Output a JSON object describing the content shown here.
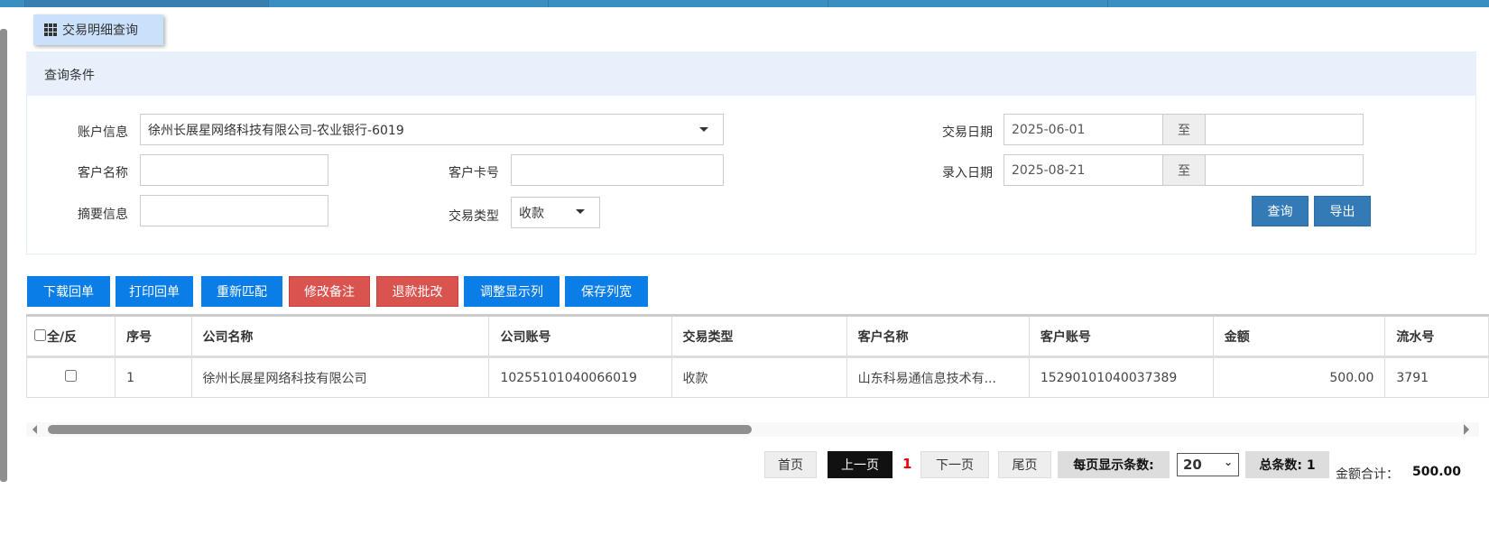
{
  "tab": {
    "label": "交易明细查询",
    "icon": "grid-icon"
  },
  "query": {
    "title": "查询条件",
    "account_label": "账户信息",
    "account_value": "徐州长展星网络科技有限公司-农业银行-6019",
    "customer_name_label": "客户名称",
    "customer_name_value": "",
    "card_label": "客户卡号",
    "card_value": "",
    "summary_label": "摘要信息",
    "summary_value": "",
    "type_label": "交易类型",
    "type_value": "收款",
    "trade_date_label": "交易日期",
    "trade_date_from": "2025-06-01",
    "trade_date_to": "",
    "entry_date_label": "录入日期",
    "entry_date_from": "2025-08-21",
    "entry_date_to": "",
    "to": "至",
    "search": "查询",
    "export": "导出"
  },
  "toolbar": [
    {
      "label": "下载回单",
      "color": "#0a7de6"
    },
    {
      "label": "打印回单",
      "color": "#0a7de6"
    },
    {
      "label": "重新匹配",
      "color": "#0a7de6"
    },
    {
      "label": "修改备注",
      "color": "#d9534f"
    },
    {
      "label": "退款批改",
      "color": "#d9534f"
    },
    {
      "label": "调整显示列",
      "color": "#0a7de6"
    },
    {
      "label": "保存列宽",
      "color": "#0a7de6"
    }
  ],
  "table": {
    "select_all": "全/反",
    "columns": [
      "序号",
      "公司名称",
      "公司账号",
      "交易类型",
      "客户名称",
      "客户账号",
      "金额",
      "流水号"
    ],
    "rows": [
      [
        "1",
        "徐州长展星网络科技有限公司",
        "10255101040066019",
        "收款",
        "山东科易通信息技术有...",
        "15290101040037389",
        "500.00",
        "3791"
      ]
    ]
  },
  "pager": {
    "first": "首页",
    "prev": "上一页",
    "current": "1",
    "next": "下一页",
    "last": "尾页",
    "per_page_label": "每页显示条数:",
    "per_page": "20",
    "total": "总条数: 1",
    "sum_label": "金额合计：",
    "sum_value": "500.00"
  }
}
